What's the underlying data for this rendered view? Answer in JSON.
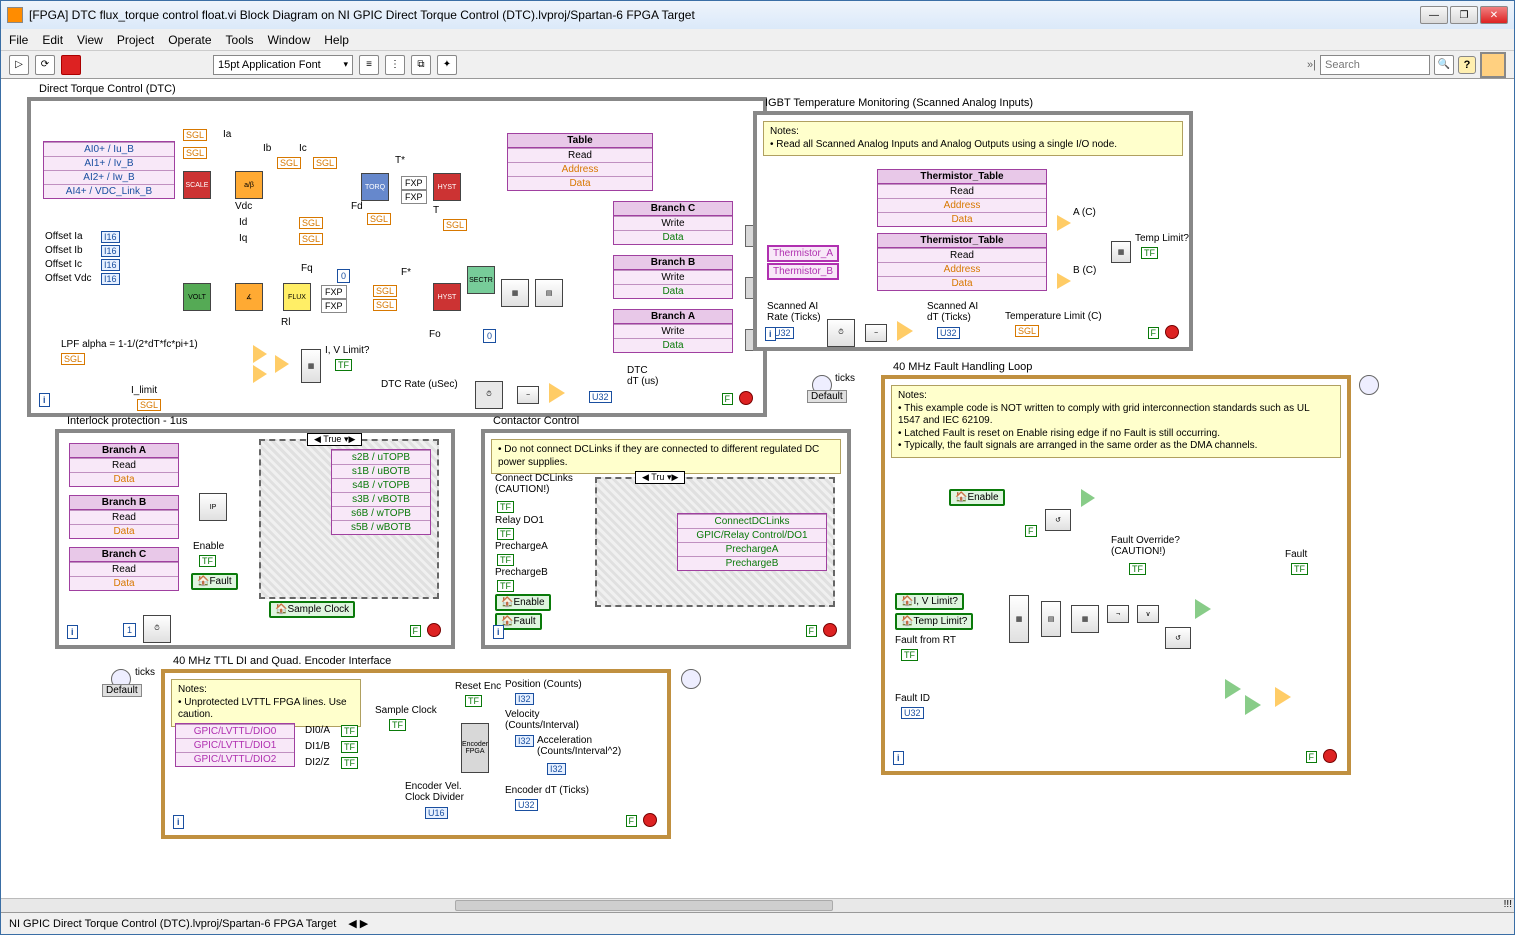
{
  "window": {
    "title": "[FPGA] DTC flux_torque control float.vi Block Diagram on NI GPIC Direct Torque Control (DTC).lvproj/Spartan-6 FPGA Target"
  },
  "menus": [
    "File",
    "Edit",
    "View",
    "Project",
    "Operate",
    "Tools",
    "Window",
    "Help"
  ],
  "toolbar": {
    "font": "15pt Application Font",
    "search_placeholder": "Search"
  },
  "loops": {
    "dtc": {
      "title": "Direct Torque Control (DTC)",
      "analog_inputs": [
        "AI0+  / Iu_B",
        "AI1+  / Iv_B",
        "AI2+  / Iw_B",
        "AI4+ / VDC_Link_B"
      ],
      "offsets": [
        "Offset Ia",
        "Offset Ib",
        "Offset Ic",
        "Offset Vdc"
      ],
      "signals": [
        "Ia",
        "Ib",
        "Ic",
        "Id",
        "Iq",
        "Vdc",
        "Fd",
        "Fq",
        "Rl",
        "Fo",
        "T",
        "T*",
        "F*"
      ],
      "lpf_text": "LPF alpha = 1-1/(2*dT*fc*pi+1)",
      "i_limit": "I_limit",
      "iv_limit": "I, V Limit?",
      "dtc_rate": "DTC Rate (uSec)",
      "dtc_dt": "DTC\ndT (us)",
      "table": {
        "hdr": "Table",
        "rows": [
          "Read",
          "Address",
          "Data"
        ]
      },
      "branches": [
        {
          "hdr": "Branch C",
          "rows": [
            "Write",
            "Data"
          ]
        },
        {
          "hdr": "Branch B",
          "rows": [
            "Write",
            "Data"
          ]
        },
        {
          "hdr": "Branch A",
          "rows": [
            "Write",
            "Data"
          ]
        }
      ]
    },
    "interlock": {
      "title": "Interlock protection - 1us",
      "branches": [
        {
          "hdr": "Branch A",
          "rows": [
            "Read",
            "Data"
          ]
        },
        {
          "hdr": "Branch B",
          "rows": [
            "Read",
            "Data"
          ]
        },
        {
          "hdr": "Branch C",
          "rows": [
            "Read",
            "Data"
          ]
        }
      ],
      "enable": "Enable",
      "fault": "Fault",
      "sample_clock": "Sample Clock",
      "case": "True",
      "half_bridge": [
        "s2B  / uTOPB",
        "s1B  / uBOTB",
        "s4B  / vTOPB",
        "s3B  / vBOTB",
        "s6B  / wTOPB",
        "s5B  / wBOTB"
      ]
    },
    "contactor": {
      "title": "Contactor Control",
      "note": "• Do not connect DCLinks if they are connected to different regulated DC power supplies.",
      "connect": "Connect DCLinks\n(CAUTION!)",
      "relay": "Relay DO1",
      "prechargeA": "PrechargeA",
      "prechargeB": "PrechargeB",
      "enable": "Enable",
      "fault": "Fault",
      "case": "Tru",
      "outs": [
        "ConnectDCLinks",
        "GPIC/Relay Control/DO1",
        "PrechargeA",
        "PrechargeB"
      ]
    },
    "encoder": {
      "title": "40 MHz TTL DI and Quad. Encoder Interface",
      "note": "Notes:\n• Unprotected LVTTL FPGA lines. Use caution.",
      "dio": [
        "GPIC/LVTTL/DIO0",
        "GPIC/LVTTL/DIO1",
        "GPIC/LVTTL/DIO2"
      ],
      "di_labels": [
        "DI0/A",
        "DI1/B",
        "DI2/Z"
      ],
      "sample_clock": "Sample Clock",
      "reset": "Reset Enc",
      "vel_div": "Encoder Vel.\nClock Divider",
      "outs": [
        "Position (Counts)",
        "Velocity\n(Counts/Interval)",
        "Acceleration\n(Counts/Interval^2)",
        "Encoder dT (Ticks)"
      ],
      "ticks": "ticks",
      "default": "Default"
    },
    "igbt": {
      "title": "IGBT Temperature Monitoring (Scanned Analog Inputs)",
      "note": "Notes:\n• Read all Scanned Analog Inputs and Analog Outputs using a single I/O node.",
      "therm_inputs": [
        "Thermistor_A",
        "Thermistor_B"
      ],
      "tables": [
        {
          "hdr": "Thermistor_Table",
          "rows": [
            "Read",
            "Address",
            "Data"
          ]
        },
        {
          "hdr": "Thermistor_Table",
          "rows": [
            "Read",
            "Address",
            "Data"
          ]
        }
      ],
      "ac": "A (C)",
      "bc": "B (C)",
      "temp_limit": "Temp Limit?",
      "scanned_rate": "Scanned AI\nRate (Ticks)",
      "scanned_dt": "Scanned AI\ndT (Ticks)",
      "temp_limit_c": "Temperature Limit (C)"
    },
    "fault": {
      "title": "40 MHz Fault Handling Loop",
      "note": "Notes:\n• This example code is NOT written to comply with grid interconnection standards such as UL 1547 and IEC 62109.\n• Latched Fault is reset on Enable rising edge if no Fault is still occurring.\n• Typically, the fault signals are arranged in the same order as the DMA channels.",
      "enable": "Enable",
      "iv_limit": "I, V Limit?",
      "temp_limit": "Temp Limit?",
      "fault_rt": "Fault from RT",
      "fault_override": "Fault Override?\n(CAUTION!)",
      "fault": "Fault",
      "fault_id": "Fault ID",
      "ticks": "ticks",
      "default": "Default"
    }
  },
  "statusbar": {
    "project": "NI GPIC Direct Torque Control (DTC).lvproj/Spartan-6 FPGA Target"
  }
}
